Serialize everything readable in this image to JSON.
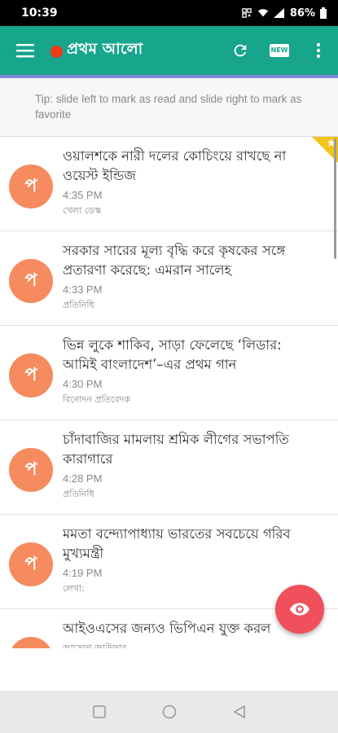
{
  "status_bar": {
    "time": "10:39",
    "battery": "86%"
  },
  "app_bar": {
    "logo_text": "প্রথম আলো",
    "new_badge": "NEW"
  },
  "tip": {
    "text": "Tip: slide left to mark as read and slide right to mark as favorite"
  },
  "news": [
    {
      "avatar": "প",
      "headline": "ওয়ালশকে নারী দলের কোচিংয়ে রাখছে না ওয়েস্ট ইন্ডিজ",
      "time": "4:35 PM",
      "author": "খেলা ডেস্ক",
      "favorite": true
    },
    {
      "avatar": "প",
      "headline": "সরকার সারের মূল্য বৃদ্ধি করে কৃষকের সঙ্গে প্রতারণা করেছে: এমরান সালেহ",
      "time": "4:33 PM",
      "author": "প্রতিনিধি",
      "favorite": false
    },
    {
      "avatar": "প",
      "headline": "ভিন্ন লুকে শাকিব, সাড়া ফেলেছে ‘লিডার: আমিই বাংলাদেশ’–এর প্রথম গান",
      "time": "4:30 PM",
      "author": "বিনোদন প্রতিবেদক",
      "favorite": false
    },
    {
      "avatar": "প",
      "headline": "চাঁদাবাজির মামলায় শ্রমিক লীগের সভাপতি কারাগারে",
      "time": "4:28 PM",
      "author": "প্রতিনিধি",
      "favorite": false
    },
    {
      "avatar": "প",
      "headline": "মমতা বন্দ্যোপাধ্যায় ভারতের সবচেয়ে গরিব মুখ্যমন্ত্রী",
      "time": "4:19 PM",
      "author": "লেখা:",
      "favorite": false
    },
    {
      "avatar": "প",
      "headline": "আইওএসের জন্যও ভিপিএন যুক্ত করল",
      "time": "",
      "author": "আসেফা জাউফার",
      "favorite": false
    }
  ],
  "icons": {
    "menu": "menu-icon",
    "refresh": "refresh-icon",
    "more": "more-vert-icon",
    "fab": "eye-icon",
    "star": "star-icon"
  },
  "colors": {
    "primary": "#17a58c",
    "accent": "#f0505b",
    "avatar": "#f58b5e",
    "favorite": "#f2c318",
    "logo_dot": "#f03a17"
  }
}
